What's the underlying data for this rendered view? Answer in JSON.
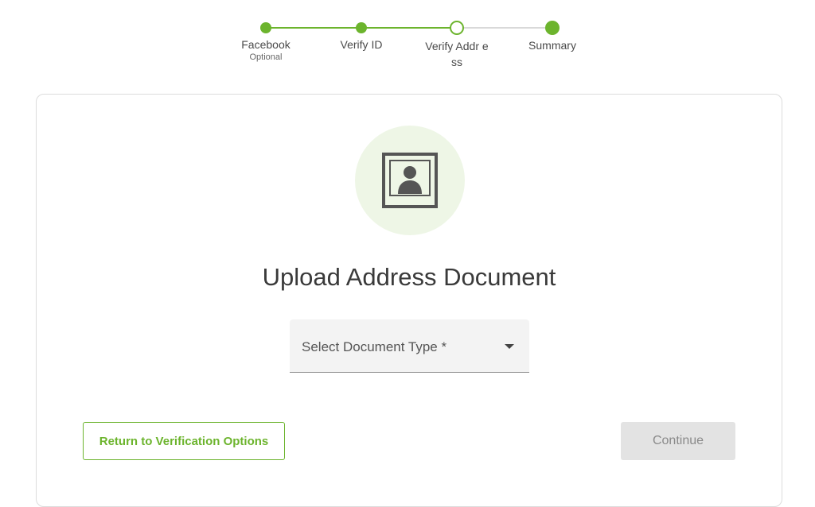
{
  "stepper": {
    "steps": [
      {
        "label": "Facebook",
        "sub": "Optional",
        "state": "done"
      },
      {
        "label": "Verify ID",
        "sub": "",
        "state": "done"
      },
      {
        "label": "Verify Addr ess",
        "sub": "",
        "state": "current"
      },
      {
        "label": "Summary",
        "sub": "",
        "state": "done"
      }
    ]
  },
  "main": {
    "icon": "portrait-photo-icon",
    "title": "Upload Address Document",
    "select": {
      "label": "Select Document Type *",
      "icon": "caret-down-icon"
    }
  },
  "actions": {
    "return_label": "Return to Verification Options",
    "continue_label": "Continue"
  },
  "colors": {
    "accent": "#6cb42d",
    "accent_light": "#eef6e6",
    "disabled_bg": "#e3e3e3",
    "disabled_text": "#8a8a8a"
  }
}
